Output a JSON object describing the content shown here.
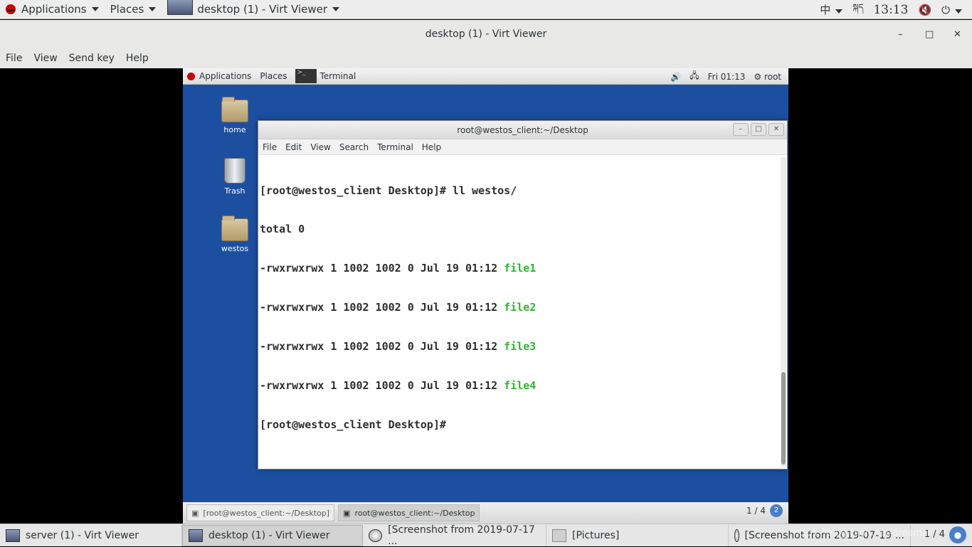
{
  "host_topbar": {
    "applications": "Applications",
    "places": "Places",
    "active_app": "desktop (1) - Virt Viewer",
    "input_method": "中",
    "locale_text": "སྐད",
    "clock": "13:13"
  },
  "window": {
    "title": "desktop (1) - Virt Viewer",
    "minimize": "–",
    "maximize": "□",
    "close": "✕"
  },
  "menubar": [
    "File",
    "View",
    "Send key",
    "Help"
  ],
  "guest_topbar": {
    "applications": "Applications",
    "places": "Places",
    "terminal": "Terminal",
    "clock": "Fri 01:13",
    "user": "root"
  },
  "desktop_icons": [
    {
      "label": "home"
    },
    {
      "label": "Trash"
    },
    {
      "label": "westos"
    }
  ],
  "terminal": {
    "title": "root@westos_client:~/Desktop",
    "menu": [
      "File",
      "Edit",
      "View",
      "Search",
      "Terminal",
      "Help"
    ],
    "lines": [
      {
        "text": "[root@westos_client Desktop]# ll westos/",
        "colored": ""
      },
      {
        "text": "total 0",
        "colored": ""
      },
      {
        "text": "-rwxrwxrwx 1 1002 1002 0 Jul 19 01:12 ",
        "colored": "file1"
      },
      {
        "text": "-rwxrwxrwx 1 1002 1002 0 Jul 19 01:12 ",
        "colored": "file2"
      },
      {
        "text": "-rwxrwxrwx 1 1002 1002 0 Jul 19 01:12 ",
        "colored": "file3"
      },
      {
        "text": "-rwxrwxrwx 1 1002 1002 0 Jul 19 01:12 ",
        "colored": "file4"
      },
      {
        "text": "[root@westos_client Desktop]#",
        "colored": ""
      }
    ],
    "file_color": "#2fb52f"
  },
  "guest_taskbar": {
    "items": [
      "[root@westos_client:~/Desktop]",
      "root@westos_client:~/Desktop"
    ],
    "page": "1 / 4",
    "page_circle": "2"
  },
  "host_taskbar": {
    "items": [
      "server (1) - Virt Viewer",
      "desktop (1) - Virt Viewer",
      "[Screenshot from 2019-07-17 ...",
      "[Pictures]",
      "[Screenshot from 2019-07-19 ..."
    ],
    "page": "1 / 4",
    "watermark": "https://blog.csdn.net/dreamer"
  }
}
